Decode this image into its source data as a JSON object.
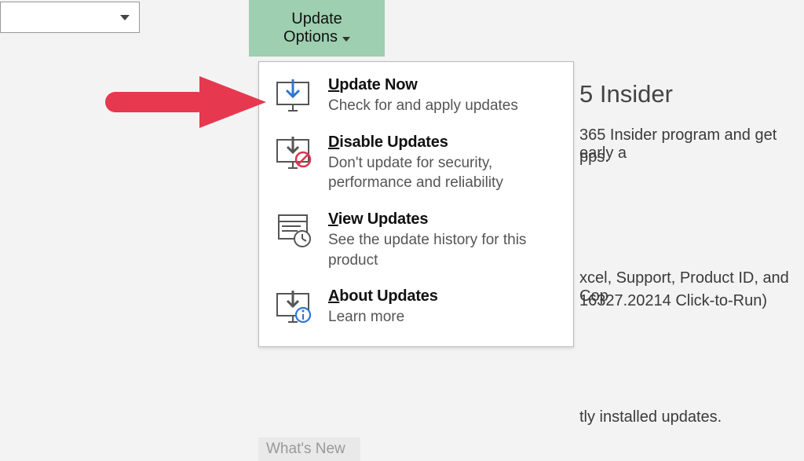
{
  "topleft_dropdown": {
    "value": ""
  },
  "update_options_button": {
    "line1": "Update",
    "line2": "Options"
  },
  "menu": {
    "items": [
      {
        "title_pre": "U",
        "title_rest": "pdate Now",
        "desc": "Check for and apply updates"
      },
      {
        "title_pre": "D",
        "title_rest": "isable Updates",
        "desc": "Don't update for security, performance and reliability"
      },
      {
        "title_pre": "V",
        "title_rest": "iew Updates",
        "desc": "See the update history for this product"
      },
      {
        "title_pre": "A",
        "title_rest": "bout Updates",
        "desc": "Learn more"
      }
    ]
  },
  "whats_new_label": "What's New",
  "background": {
    "title_partial": "5 Insider",
    "program_line_a": "365 Insider program and get early a",
    "program_line_b": "pps.",
    "about_line_a": "xcel, Support, Product ID, and Cop",
    "about_line_b": " 16327.20214 Click-to-Run)",
    "installed_line": "tly installed updates."
  },
  "annotation": {
    "arrow_color": "#e6384f"
  }
}
